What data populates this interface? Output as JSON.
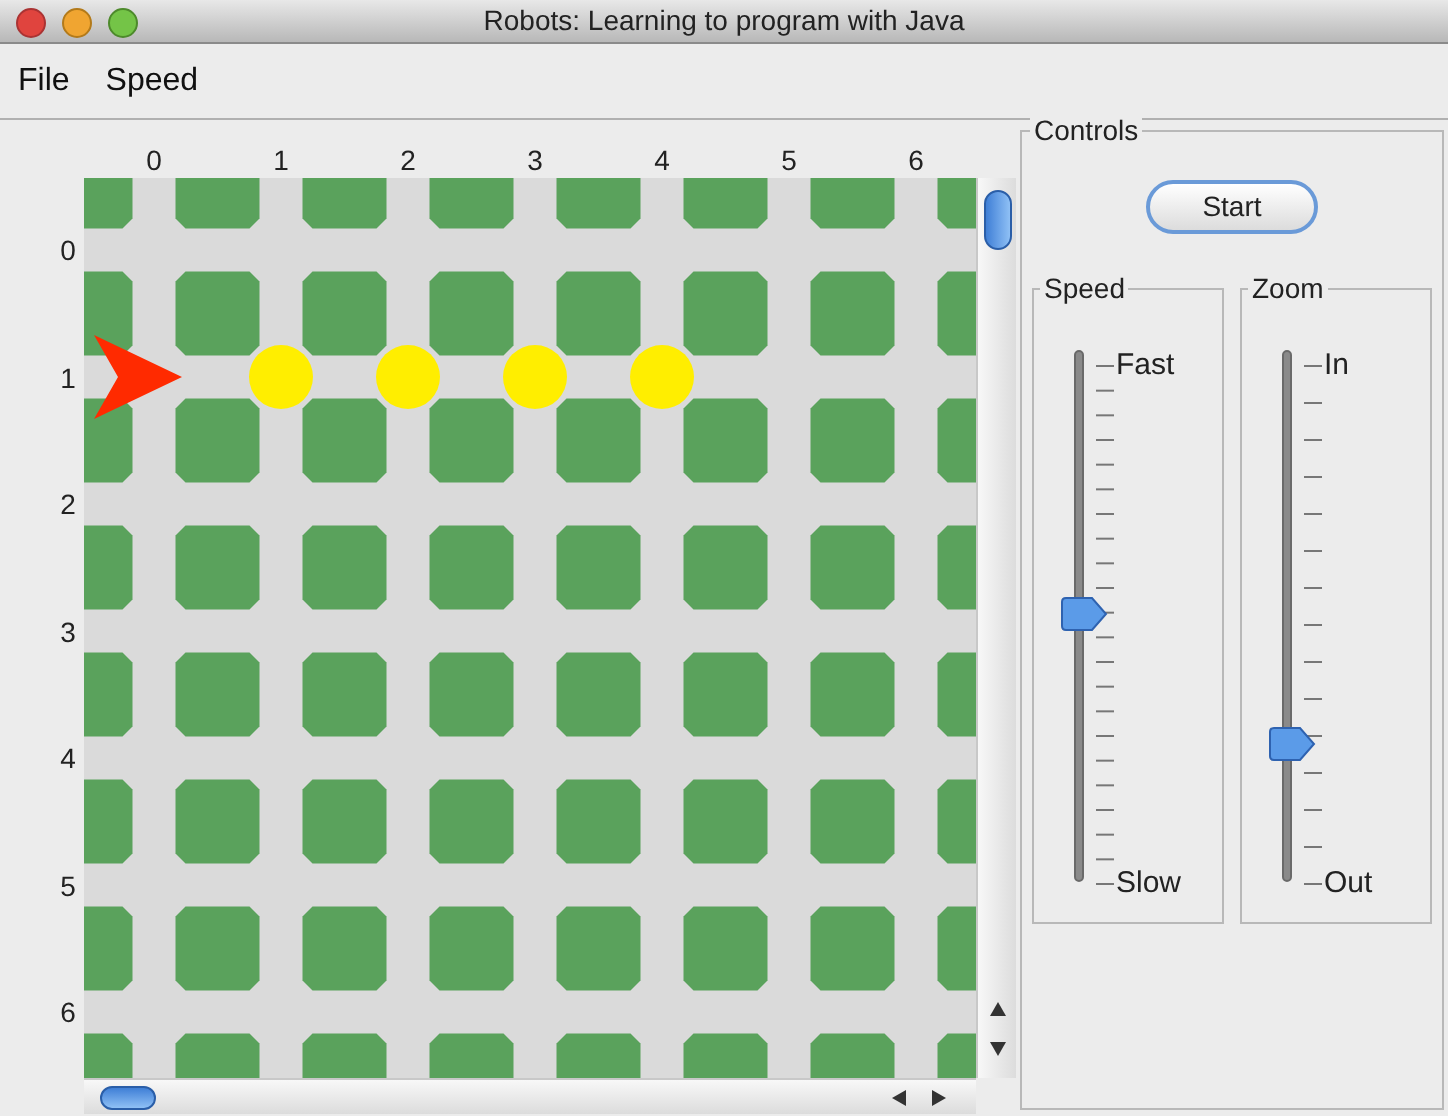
{
  "window": {
    "title": "Robots: Learning to program with Java"
  },
  "menu": [
    {
      "label": "File"
    },
    {
      "label": "Speed"
    }
  ],
  "city": {
    "avenue_labels": [
      "0",
      "1",
      "2",
      "3",
      "4",
      "5",
      "6"
    ],
    "streets": [
      {
        "label": "0",
        "intersections": [
          {
            "kind": "empty"
          },
          {
            "kind": "empty"
          },
          {
            "kind": "empty"
          },
          {
            "kind": "empty"
          },
          {
            "kind": "empty"
          },
          {
            "kind": "empty"
          },
          {
            "kind": "empty"
          }
        ]
      },
      {
        "label": "1",
        "intersections": [
          {
            "kind": "robot"
          },
          {
            "kind": "thing"
          },
          {
            "kind": "thing"
          },
          {
            "kind": "thing"
          },
          {
            "kind": "thing"
          },
          {
            "kind": "empty"
          },
          {
            "kind": "empty"
          }
        ]
      },
      {
        "label": "2",
        "intersections": [
          {
            "kind": "empty"
          },
          {
            "kind": "empty"
          },
          {
            "kind": "empty"
          },
          {
            "kind": "empty"
          },
          {
            "kind": "empty"
          },
          {
            "kind": "empty"
          },
          {
            "kind": "empty"
          }
        ]
      },
      {
        "label": "3",
        "intersections": [
          {
            "kind": "empty"
          },
          {
            "kind": "empty"
          },
          {
            "kind": "empty"
          },
          {
            "kind": "empty"
          },
          {
            "kind": "empty"
          },
          {
            "kind": "empty"
          },
          {
            "kind": "empty"
          }
        ]
      },
      {
        "label": "4",
        "intersections": [
          {
            "kind": "empty"
          },
          {
            "kind": "empty"
          },
          {
            "kind": "empty"
          },
          {
            "kind": "empty"
          },
          {
            "kind": "empty"
          },
          {
            "kind": "empty"
          },
          {
            "kind": "empty"
          }
        ]
      },
      {
        "label": "5",
        "intersections": [
          {
            "kind": "empty"
          },
          {
            "kind": "empty"
          },
          {
            "kind": "empty"
          },
          {
            "kind": "empty"
          },
          {
            "kind": "empty"
          },
          {
            "kind": "empty"
          },
          {
            "kind": "empty"
          }
        ]
      },
      {
        "label": "6",
        "intersections": [
          {
            "kind": "empty"
          },
          {
            "kind": "empty"
          },
          {
            "kind": "empty"
          },
          {
            "kind": "empty"
          },
          {
            "kind": "empty"
          },
          {
            "kind": "empty"
          },
          {
            "kind": "empty"
          }
        ]
      }
    ]
  },
  "controls": {
    "title": "Controls",
    "start_button": "Start",
    "sliders": [
      {
        "title": "Speed",
        "top_label": "Fast",
        "bottom_label": "Slow",
        "level": 0.52,
        "kind": "fine"
      },
      {
        "title": "Zoom",
        "top_label": "In",
        "bottom_label": "Out",
        "level": 0.27,
        "kind": "coarse"
      }
    ]
  }
}
